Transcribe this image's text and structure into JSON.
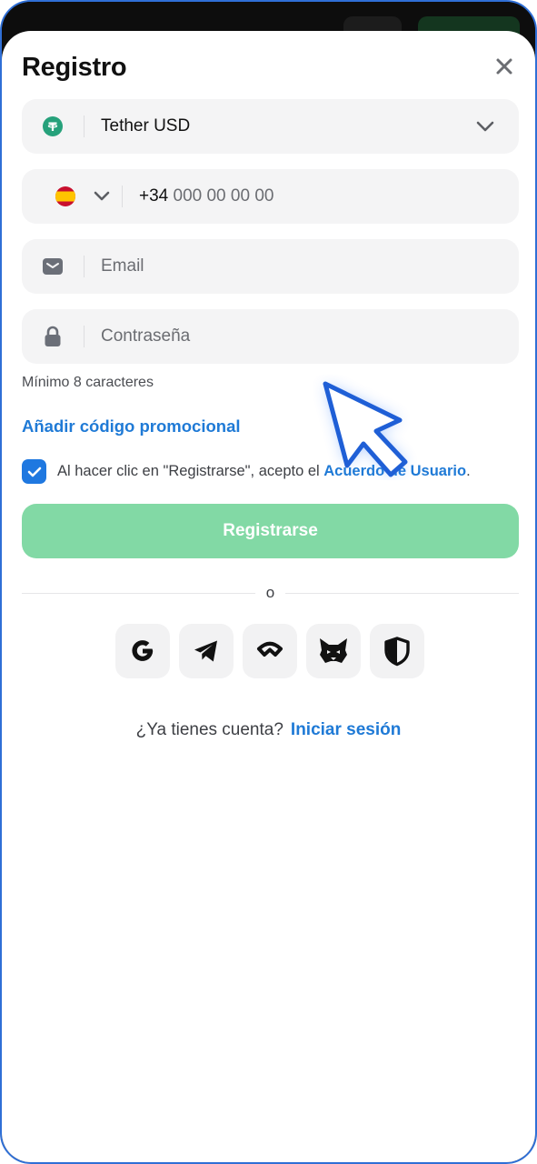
{
  "dialog": {
    "title": "Registro"
  },
  "currency": {
    "selected": "Tether USD",
    "icon": "tether-icon"
  },
  "phone": {
    "country_flag": "spain-flag-icon",
    "prefix": "+34",
    "placeholder": "000 00 00 00"
  },
  "email": {
    "placeholder": "Email",
    "icon": "mail-icon"
  },
  "password": {
    "placeholder": "Contraseña",
    "icon": "lock-icon",
    "helper": "Mínimo 8 caracteres"
  },
  "promo": {
    "label": "Añadir código promocional"
  },
  "consent": {
    "checked": true,
    "text": "Al hacer clic en \"Registrarse\", acepto el ",
    "link": "Acuerdo de Usuario",
    "suffix": "."
  },
  "submit": {
    "label": "Registrarse"
  },
  "divider": {
    "label": "o"
  },
  "social": [
    {
      "name": "google-icon"
    },
    {
      "name": "telegram-icon"
    },
    {
      "name": "walletconnect-icon"
    },
    {
      "name": "metamask-icon"
    },
    {
      "name": "shield-icon"
    }
  ],
  "login": {
    "prompt": "¿Ya tienes cuenta?",
    "link": "Iniciar sesión"
  },
  "colors": {
    "accent": "#1f7ad6",
    "submit_bg": "#82d9a5",
    "checkbox": "#1f78e0",
    "field_bg": "#f4f4f5",
    "tether": "#26a17b"
  }
}
